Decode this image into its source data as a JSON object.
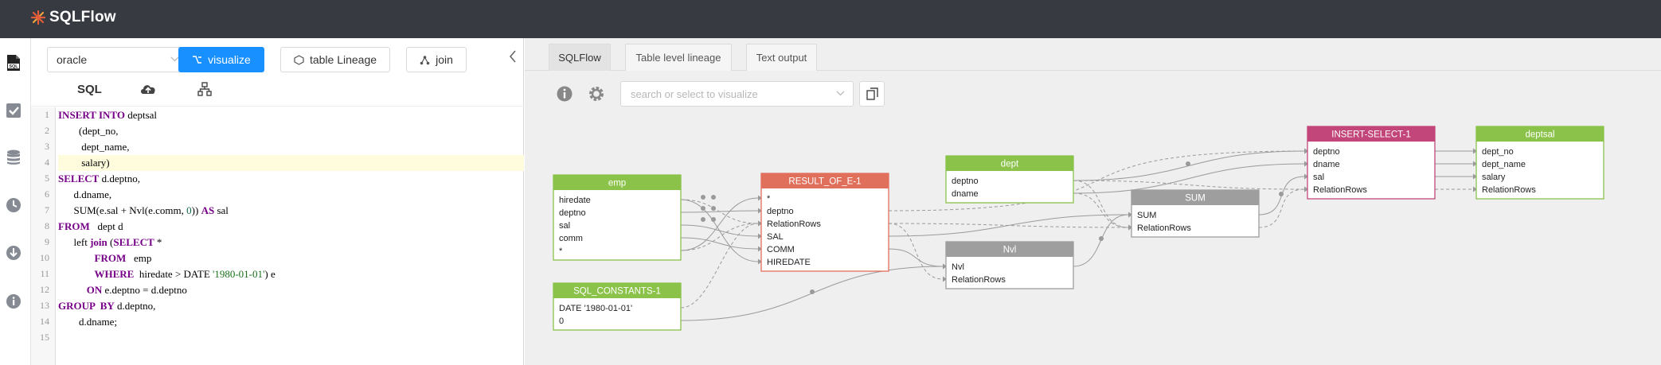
{
  "app": {
    "title": "SQLFlow"
  },
  "left": {
    "db_select": "oracle",
    "buttons": {
      "visualize": "visualize",
      "table_lineage": "table Lineage",
      "join": "join"
    },
    "subtabs": {
      "sql": "SQL"
    }
  },
  "editor": {
    "lines": [
      {
        "n": "1"
      },
      {
        "n": "2"
      },
      {
        "n": "3"
      },
      {
        "n": "4"
      },
      {
        "n": "5"
      },
      {
        "n": "6"
      },
      {
        "n": "7"
      },
      {
        "n": "8"
      },
      {
        "n": "9"
      },
      {
        "n": "10"
      },
      {
        "n": "11"
      },
      {
        "n": "12"
      },
      {
        "n": "13"
      },
      {
        "n": "14"
      },
      {
        "n": "15"
      }
    ],
    "tokens": {
      "l1a": "INSERT INTO",
      "l1b": " deptsal",
      "l2": "        (dept_no,",
      "l3": "         dept_name,",
      "l4": "         salary)",
      "l5a": "SELECT",
      "l5b": " d.deptno,",
      "l6": "      d.dname,",
      "l7a": "      SUM(e.sal + Nvl(e.comm, ",
      "l7b": "0",
      "l7c": ")) ",
      "l7d": "AS",
      "l7e": " sal",
      "l8a": "FROM",
      "l8b": "   dept d",
      "l9a": "      left ",
      "l9b": "join",
      "l9c": " (",
      "l9d": "SELECT",
      "l9e": " *",
      "l10a": "              ",
      "l10b": "FROM",
      "l10c": "   emp",
      "l11a": "              ",
      "l11b": "WHERE",
      "l11c": "  hiredate > DATE ",
      "l11d": "'1980-01-01'",
      "l11e": ") e",
      "l12a": "           ",
      "l12b": "ON",
      "l12c": " e.deptno = d.deptno",
      "l13a": "GROUP  BY",
      "l13b": " d.deptno,",
      "l14": "        d.dname;"
    }
  },
  "right": {
    "tabs": [
      "SQLFlow",
      "Table level lineage",
      "Text output"
    ],
    "search_placeholder": "search or select to visualize"
  },
  "nodes": {
    "emp": {
      "title": "emp",
      "cols": [
        "hiredate",
        "deptno",
        "sal",
        "comm",
        "*"
      ]
    },
    "consts": {
      "title": "SQL_CONSTANTS-1",
      "cols": [
        "DATE '1980-01-01'",
        "0"
      ]
    },
    "result": {
      "title": "RESULT_OF_E-1",
      "cols": [
        "*",
        "deptno",
        "RelationRows",
        "SAL",
        "COMM",
        "HIREDATE"
      ]
    },
    "dept": {
      "title": "dept",
      "cols": [
        "deptno",
        "dname"
      ]
    },
    "nvl": {
      "title": "Nvl",
      "cols": [
        "Nvl",
        "RelationRows"
      ]
    },
    "sum": {
      "title": "SUM",
      "cols": [
        "SUM",
        "RelationRows"
      ]
    },
    "insert": {
      "title": "INSERT-SELECT-1",
      "cols": [
        "deptno",
        "dname",
        "sal",
        "RelationRows"
      ]
    },
    "deptsal": {
      "title": "deptsal",
      "cols": [
        "dept_no",
        "dept_name",
        "salary",
        "RelationRows"
      ]
    }
  },
  "colors": {
    "topbar": "#373a41",
    "accent": "#1890ff",
    "node_table": "#8bc34a",
    "node_result": "#e0705c",
    "node_function": "#9e9e9e",
    "node_insert": "#c2467a",
    "edge": "#9a9a9a"
  },
  "icons": [
    "sql-file-icon",
    "checkbox-icon",
    "database-icon",
    "clock-icon",
    "download-icon",
    "info-icon"
  ]
}
